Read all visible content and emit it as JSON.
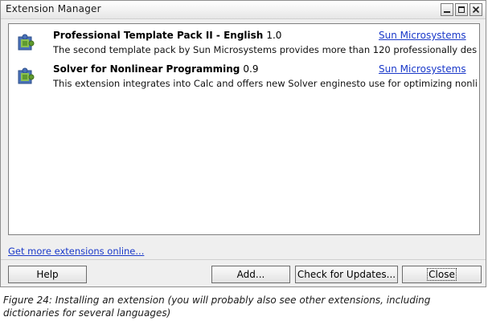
{
  "window": {
    "title": "Extension Manager",
    "controls": [
      "minimize-icon",
      "maximize-icon",
      "close-icon"
    ]
  },
  "extensions": [
    {
      "name": "Professional Template Pack II - English",
      "version": "1.0",
      "publisher": "Sun Microsystems",
      "description": "The second template pack by Sun Microsystems provides more than 120 professionally designed doc...",
      "icon": "puzzle-piece-icon"
    },
    {
      "name": "Solver for Nonlinear Programming",
      "version": "0.9",
      "publisher": "Sun Microsystems",
      "description": "This extension integrates into Calc and offers new Solver enginesto use for optimizing nonlinear pro...",
      "icon": "puzzle-piece-icon"
    }
  ],
  "more_extensions_link": "Get more extensions online...",
  "buttons": {
    "help": "Help",
    "add": "Add...",
    "check_updates": "Check for Updates...",
    "close": "Close"
  },
  "caption": "Figure 24: Installing an extension (you will probably also see other extensions, including dictionaries for several languages)",
  "colors": {
    "link": "#1a39c9",
    "window_bg": "#efefef",
    "list_bg": "#ffffff",
    "icon_green": "#5f9a2f",
    "icon_blue": "#4a72b8"
  }
}
